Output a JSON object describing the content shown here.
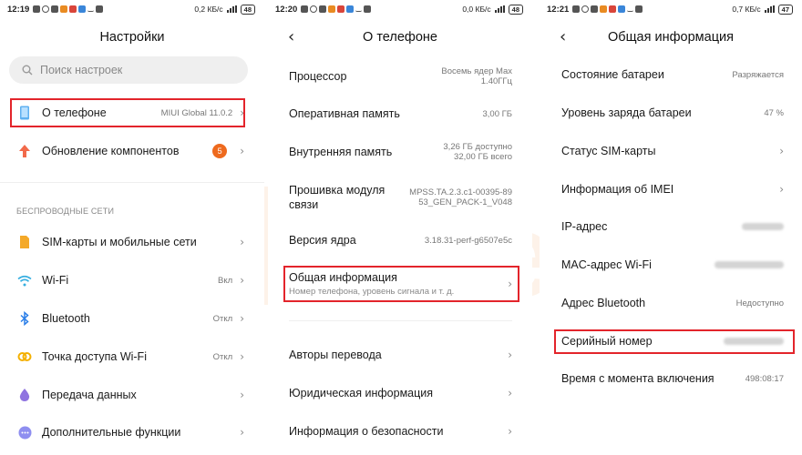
{
  "screen1": {
    "status": {
      "time": "12:19",
      "speed": "0,2 КБ/с",
      "battery": "48"
    },
    "title": "Настройки",
    "search_placeholder": "Поиск настроек",
    "about": {
      "label": "О телефоне",
      "value": "MIUI Global 11.0.2"
    },
    "updates": {
      "label": "Обновление компонентов",
      "badge": "5"
    },
    "section": "БЕСПРОВОДНЫЕ СЕТИ",
    "items": [
      {
        "label": "SIM-карты и мобильные сети",
        "value": "",
        "icon": "sim-icon"
      },
      {
        "label": "Wi-Fi",
        "value": "Вкл",
        "icon": "wifi-icon"
      },
      {
        "label": "Bluetooth",
        "value": "Откл",
        "icon": "bluetooth-icon"
      },
      {
        "label": "Точка доступа Wi-Fi",
        "value": "Откл",
        "icon": "hotspot-icon"
      },
      {
        "label": "Передача данных",
        "value": "",
        "icon": "data-usage-icon"
      },
      {
        "label": "Дополнительные функции",
        "value": "",
        "icon": "more-icon"
      }
    ]
  },
  "screen2": {
    "status": {
      "time": "12:20",
      "speed": "0,0 КБ/с",
      "battery": "48"
    },
    "title": "О телефоне",
    "specs": [
      {
        "label": "Процессор",
        "value1": "Восемь ядер Max",
        "value2": "1.40ГГц"
      },
      {
        "label": "Оперативная память",
        "value1": "3,00 ГБ",
        "value2": ""
      },
      {
        "label": "Внутренняя память",
        "value1": "3,26 ГБ доступно",
        "value2": "32,00 ГБ всего"
      },
      {
        "label1": "Прошивка модуля",
        "label2": "связи",
        "value1": "MPSS.TA.2.3.c1-00395-89",
        "value2": "53_GEN_PACK-1_V048"
      },
      {
        "label": "Версия ядра",
        "value1": "3.18.31-perf-g6507e5c",
        "value2": ""
      }
    ],
    "general": {
      "label": "Общая информация",
      "subtitle": "Номер телефона, уровень сигнала и т. д."
    },
    "links": [
      {
        "label": "Авторы перевода"
      },
      {
        "label": "Юридическая информация"
      },
      {
        "label": "Информация о безопасности"
      }
    ]
  },
  "screen3": {
    "status": {
      "time": "12:21",
      "speed": "0,7 КБ/с",
      "battery": "47"
    },
    "title": "Общая информация",
    "rows": [
      {
        "label": "Состояние батареи",
        "value": "Разряжается"
      },
      {
        "label": "Уровень заряда батареи",
        "value": "47 %"
      },
      {
        "label": "Статус SIM-карты",
        "value": ""
      },
      {
        "label": "Информация об IMEI",
        "value": ""
      },
      {
        "label": "IP-адрес",
        "value": ""
      },
      {
        "label": "MAC-адрес Wi-Fi",
        "value": ""
      },
      {
        "label": "Адрес Bluetooth",
        "value": "Недоступно"
      },
      {
        "label": "Серийный номер",
        "value": ""
      },
      {
        "label": "Время с момента включения",
        "value": "498:08:17"
      }
    ]
  },
  "watermark": "mi geek",
  "colors": {
    "highlight": "#e3242b",
    "badge": "#ee6a1e",
    "accent": "#2a7ee8"
  }
}
